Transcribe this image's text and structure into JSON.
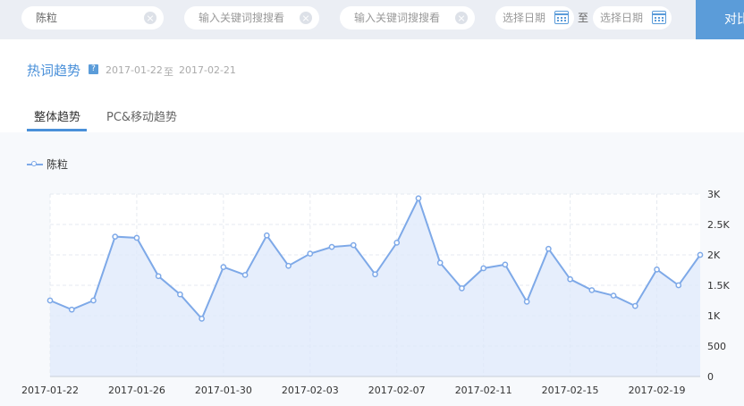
{
  "search": {
    "field1_value": "陈粒",
    "field2_placeholder": "输入关键词搜搜看",
    "field3_placeholder": "输入关键词搜搜看",
    "date_start_placeholder": "选择日期",
    "date_separator": "至",
    "date_end_placeholder": "选择日期",
    "compare_label": "对比"
  },
  "section": {
    "title": "热词趋势",
    "help_icon_text": "?",
    "start_date": "2017-01-22",
    "separator": "至",
    "end_date": "2017-02-21"
  },
  "tabs": [
    {
      "label": "整体趋势",
      "active": true
    },
    {
      "label": "PC&移动趋势",
      "active": false
    }
  ],
  "colors": {
    "accent": "#4a90d9",
    "series": "#7ea9e8",
    "area": "#dde8fb"
  },
  "chart_data": {
    "type": "area",
    "x": [
      "2017-01-22",
      "2017-01-23",
      "2017-01-24",
      "2017-01-25",
      "2017-01-26",
      "2017-01-27",
      "2017-01-28",
      "2017-01-29",
      "2017-01-30",
      "2017-01-31",
      "2017-02-01",
      "2017-02-02",
      "2017-02-03",
      "2017-02-04",
      "2017-02-05",
      "2017-02-06",
      "2017-02-07",
      "2017-02-08",
      "2017-02-09",
      "2017-02-10",
      "2017-02-11",
      "2017-02-12",
      "2017-02-13",
      "2017-02-14",
      "2017-02-15",
      "2017-02-16",
      "2017-02-17",
      "2017-02-18",
      "2017-02-19",
      "2017-02-20",
      "2017-02-21"
    ],
    "xticks": [
      "2017-01-22",
      "2017-01-26",
      "2017-01-30",
      "2017-02-03",
      "2017-02-07",
      "2017-02-11",
      "2017-02-15",
      "2017-02-19"
    ],
    "series": [
      {
        "name": "陈粒",
        "values": [
          1250,
          1100,
          1250,
          2300,
          2280,
          1650,
          1350,
          950,
          1800,
          1670,
          2320,
          1820,
          2020,
          2130,
          2160,
          1680,
          2200,
          2930,
          1870,
          1450,
          1780,
          1840,
          1230,
          2100,
          1600,
          1420,
          1330,
          1160,
          1760,
          1500,
          2000
        ]
      }
    ],
    "ylim": [
      0,
      3000
    ],
    "yticks": [
      0,
      500,
      1000,
      1500,
      2000,
      2500,
      3000
    ],
    "ytick_labels": [
      "0",
      "500",
      "1K",
      "1.5K",
      "2K",
      "2.5K",
      "3K"
    ],
    "title": "",
    "xlabel": "",
    "ylabel": "",
    "legend_position": "top-left",
    "grid": true
  }
}
